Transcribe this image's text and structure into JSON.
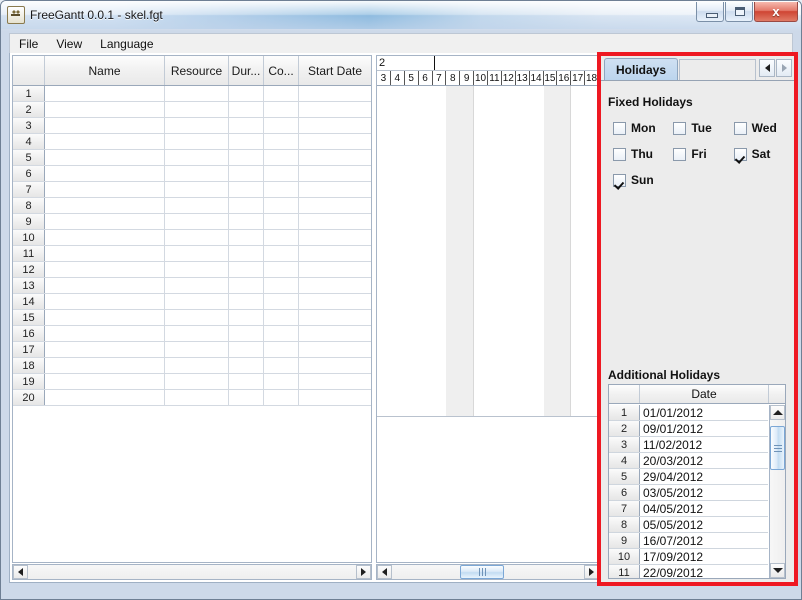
{
  "window": {
    "title": "FreeGantt 0.0.1 - skel.fgt",
    "app_icon": "java-coffee-cup-icon",
    "minimize_label": "",
    "maximize_label": "",
    "close_label": "x"
  },
  "menubar": {
    "items": [
      {
        "label": "File"
      },
      {
        "label": "View"
      },
      {
        "label": "Language"
      }
    ]
  },
  "task_table": {
    "columns": [
      {
        "key": "rownum",
        "label": ""
      },
      {
        "key": "name",
        "label": "Name"
      },
      {
        "key": "resource",
        "label": "Resource"
      },
      {
        "key": "duration",
        "label": "Dur..."
      },
      {
        "key": "cost",
        "label": "Co..."
      },
      {
        "key": "start_date",
        "label": "Start Date"
      }
    ],
    "rows": [
      {
        "num": "1",
        "name": "",
        "resource": "",
        "duration": "",
        "cost": "",
        "start_date": ""
      },
      {
        "num": "2",
        "name": "",
        "resource": "",
        "duration": "",
        "cost": "",
        "start_date": ""
      },
      {
        "num": "3",
        "name": "",
        "resource": "",
        "duration": "",
        "cost": "",
        "start_date": ""
      },
      {
        "num": "4",
        "name": "",
        "resource": "",
        "duration": "",
        "cost": "",
        "start_date": ""
      },
      {
        "num": "5",
        "name": "",
        "resource": "",
        "duration": "",
        "cost": "",
        "start_date": ""
      },
      {
        "num": "6",
        "name": "",
        "resource": "",
        "duration": "",
        "cost": "",
        "start_date": ""
      },
      {
        "num": "7",
        "name": "",
        "resource": "",
        "duration": "",
        "cost": "",
        "start_date": ""
      },
      {
        "num": "8",
        "name": "",
        "resource": "",
        "duration": "",
        "cost": "",
        "start_date": ""
      },
      {
        "num": "9",
        "name": "",
        "resource": "",
        "duration": "",
        "cost": "",
        "start_date": ""
      },
      {
        "num": "10",
        "name": "",
        "resource": "",
        "duration": "",
        "cost": "",
        "start_date": ""
      },
      {
        "num": "11",
        "name": "",
        "resource": "",
        "duration": "",
        "cost": "",
        "start_date": ""
      },
      {
        "num": "12",
        "name": "",
        "resource": "",
        "duration": "",
        "cost": "",
        "start_date": ""
      },
      {
        "num": "13",
        "name": "",
        "resource": "",
        "duration": "",
        "cost": "",
        "start_date": ""
      },
      {
        "num": "14",
        "name": "",
        "resource": "",
        "duration": "",
        "cost": "",
        "start_date": ""
      },
      {
        "num": "15",
        "name": "",
        "resource": "",
        "duration": "",
        "cost": "",
        "start_date": ""
      },
      {
        "num": "16",
        "name": "",
        "resource": "",
        "duration": "",
        "cost": "",
        "start_date": ""
      },
      {
        "num": "17",
        "name": "",
        "resource": "",
        "duration": "",
        "cost": "",
        "start_date": ""
      },
      {
        "num": "18",
        "name": "",
        "resource": "",
        "duration": "",
        "cost": "",
        "start_date": ""
      },
      {
        "num": "19",
        "name": "",
        "resource": "",
        "duration": "",
        "cost": "",
        "start_date": ""
      },
      {
        "num": "20",
        "name": "",
        "resource": "",
        "duration": "",
        "cost": "",
        "start_date": ""
      }
    ]
  },
  "gantt": {
    "week_labels": [
      "2"
    ],
    "day_labels": [
      "3",
      "4",
      "5",
      "6",
      "7",
      "8",
      "9",
      "10",
      "11",
      "12",
      "13",
      "14",
      "15",
      "16",
      "17",
      "18"
    ],
    "weekend_days": [
      "8",
      "9",
      "15",
      "16"
    ],
    "weekend_color": "#efefef",
    "bars": []
  },
  "holidays_panel": {
    "tab_label": "Holidays",
    "tab_scroll_left": "◀",
    "tab_scroll_right": "▶",
    "fixed_title": "Fixed Holidays",
    "weekdays": [
      {
        "label": "Mon",
        "checked": false
      },
      {
        "label": "Tue",
        "checked": false
      },
      {
        "label": "Wed",
        "checked": false
      },
      {
        "label": "Thu",
        "checked": false
      },
      {
        "label": "Fri",
        "checked": false
      },
      {
        "label": "Sat",
        "checked": true
      },
      {
        "label": "Sun",
        "checked": true
      }
    ],
    "additional_title": "Additional Holidays",
    "additional_columns": [
      "",
      "Date"
    ],
    "additional_rows": [
      {
        "num": "1",
        "date": "01/01/2012"
      },
      {
        "num": "2",
        "date": "09/01/2012"
      },
      {
        "num": "3",
        "date": "11/02/2012"
      },
      {
        "num": "4",
        "date": "20/03/2012"
      },
      {
        "num": "5",
        "date": "29/04/2012"
      },
      {
        "num": "6",
        "date": "03/05/2012"
      },
      {
        "num": "7",
        "date": "04/05/2012"
      },
      {
        "num": "8",
        "date": "05/05/2012"
      },
      {
        "num": "9",
        "date": "16/07/2012"
      },
      {
        "num": "10",
        "date": "17/09/2012"
      },
      {
        "num": "11",
        "date": "22/09/2012"
      }
    ]
  },
  "annotation": {
    "highlight_color": "#ee1822"
  }
}
